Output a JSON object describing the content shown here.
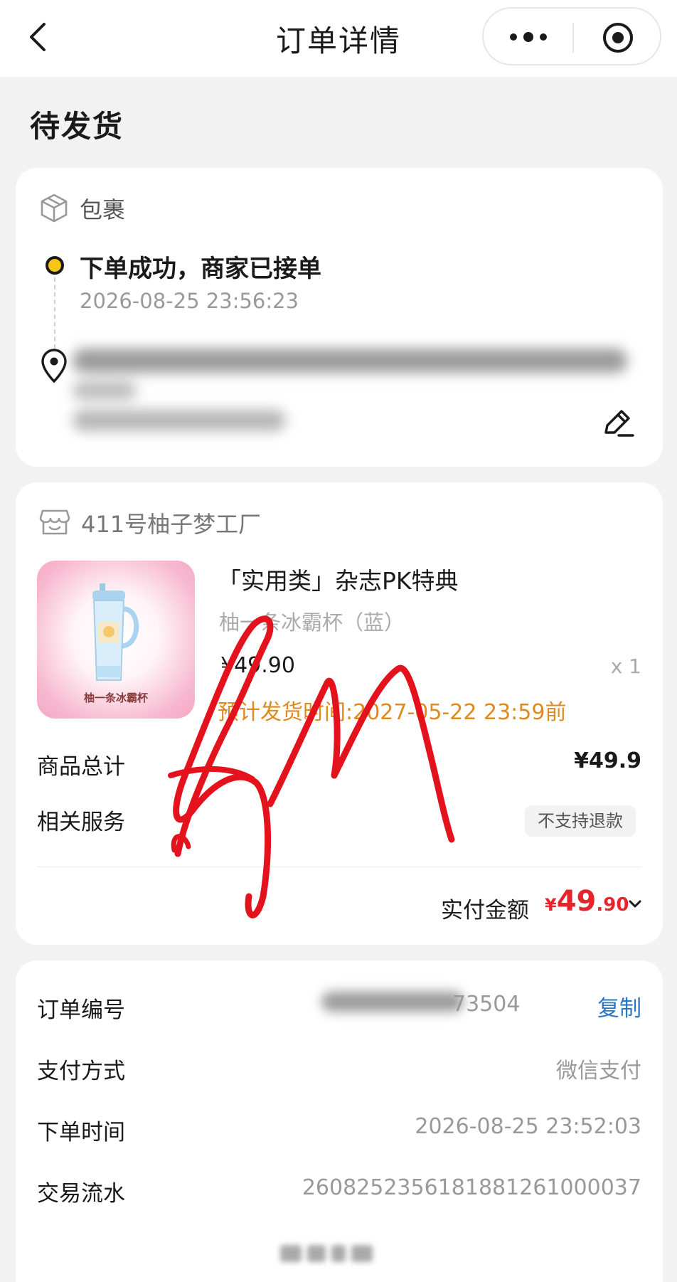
{
  "nav": {
    "title": "订单详情"
  },
  "status": {
    "title": "待发货"
  },
  "package": {
    "label": "包裹",
    "timeline_title": "下单成功，商家已接单",
    "timeline_time": "2026-08-25 23:56:23"
  },
  "order": {
    "shop_name": "411号柚子梦工厂",
    "product": {
      "image_caption": "柚一条冰霸杯",
      "name": "「实用类」杂志PK特典",
      "spec": "柚一条冰霸杯（蓝）",
      "price": "¥49.90",
      "quantity": "x 1",
      "ship_time": "预计发货时间:2027-05-22 23:59前"
    },
    "subtotal_label": "商品总计",
    "subtotal_value": "¥49.9",
    "service_label": "相关服务",
    "service_tag": "不支持退款",
    "paid_label": "实付金额",
    "paid_currency": "¥",
    "paid_integer": "49",
    "paid_decimal": ".90"
  },
  "info": {
    "order_no_label": "订单编号",
    "order_no_visible_suffix": "73504",
    "copy_label": "复制",
    "payment_label": "支付方式",
    "payment_value": "微信支付",
    "time_label": "下单时间",
    "time_value": "2026-08-25 23:52:03",
    "txn_label": "交易流水",
    "txn_value": "2608252356181881261000037"
  },
  "colors": {
    "accent_red": "#e5252b",
    "ship_orange": "#e08a1e",
    "link_blue": "#2b78c5",
    "timeline_yellow": "#f5c518"
  }
}
